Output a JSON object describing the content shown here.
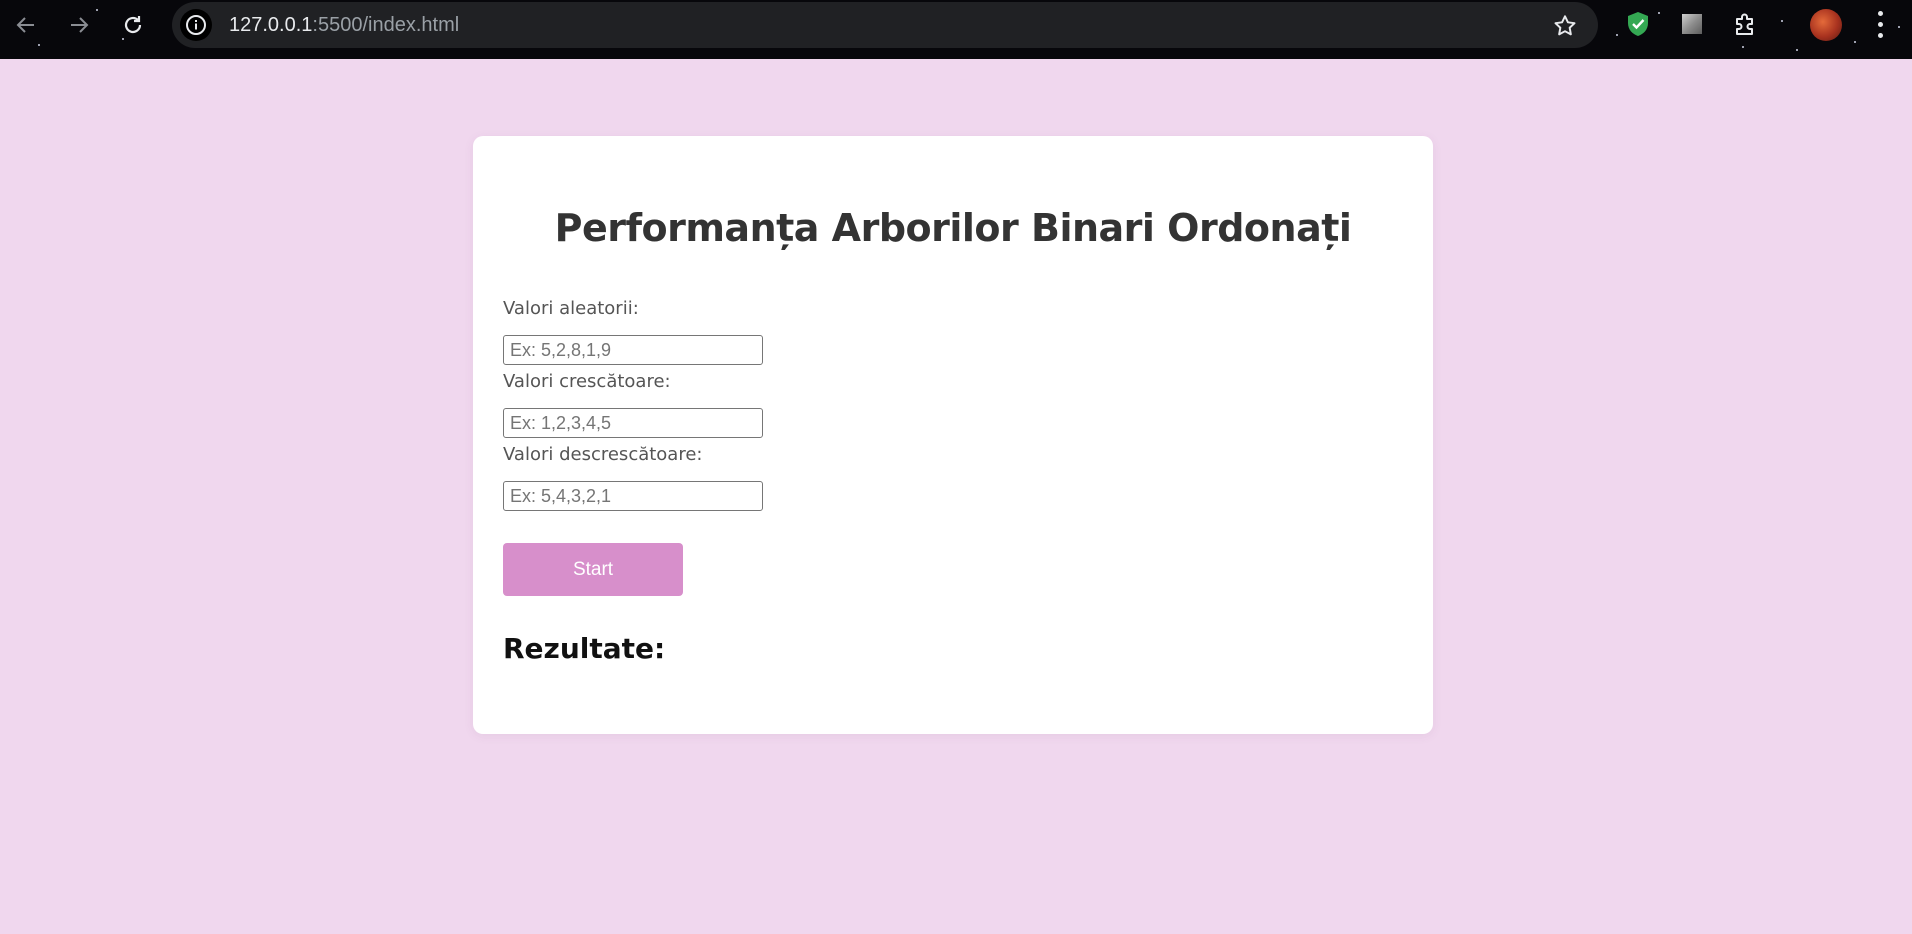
{
  "browser": {
    "url_host": "127.0.0.1",
    "url_path": ":5500/index.html",
    "icons": {
      "back": "arrow-left-icon",
      "forward": "arrow-right-icon",
      "reload": "reload-icon",
      "site_info": "info-icon",
      "bookmark": "star-icon",
      "extension_shield": "shield-check-icon",
      "extension_square": "square-icon",
      "extensions": "puzzle-icon",
      "profile": "avatar",
      "menu": "kebab-icon"
    },
    "colors": {
      "toolbar_bg": "#07070b",
      "omnibox_bg": "#202124",
      "shield_green": "#34a853"
    }
  },
  "page": {
    "title": "Performanța Arborilor Binari Ordonați",
    "fields": [
      {
        "label": "Valori aleatorii:",
        "placeholder": "Ex: 5,2,8,1,9",
        "value": ""
      },
      {
        "label": "Valori crescătoare:",
        "placeholder": "Ex: 1,2,3,4,5",
        "value": ""
      },
      {
        "label": "Valori descrescătoare:",
        "placeholder": "Ex: 5,4,3,2,1",
        "value": ""
      }
    ],
    "start_button": "Start",
    "results_heading": "Rezultate:",
    "colors": {
      "background": "#f0d7ee",
      "card": "#ffffff",
      "button": "#d78fcb"
    }
  }
}
